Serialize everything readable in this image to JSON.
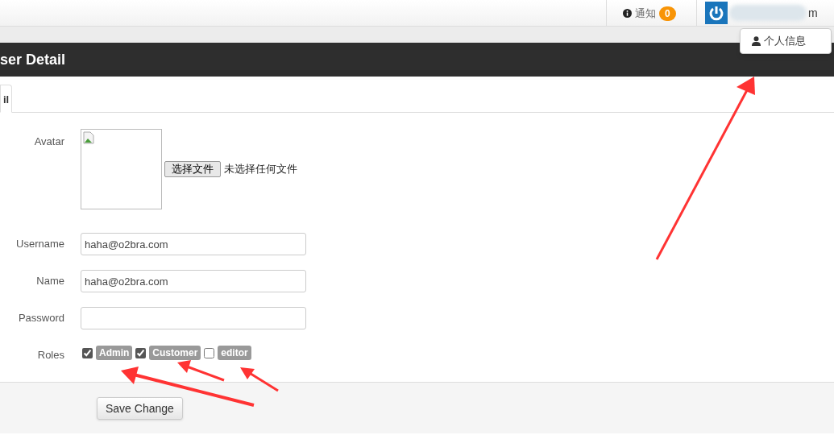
{
  "top_bar": {
    "notifications": {
      "label": "通知",
      "count": "0"
    },
    "user": {
      "name_tail": "m"
    },
    "dropdown": {
      "items": [
        "个人信息"
      ]
    }
  },
  "header": {
    "title": "ser Detail"
  },
  "tabs": [
    {
      "label": "il",
      "selected": true
    }
  ],
  "form": {
    "avatar": {
      "label": "Avatar",
      "file_button": "选择文件",
      "file_status": "未选择任何文件"
    },
    "fields": [
      {
        "label": "Username",
        "value": "haha@o2bra.com"
      },
      {
        "label": "Name",
        "value": "haha@o2bra.com"
      },
      {
        "label": "Password"
      }
    ],
    "roles": {
      "label": "Roles",
      "items": [
        {
          "name": "Admin",
          "checked": true
        },
        {
          "name": "Customer",
          "checked": true
        },
        {
          "name": "editor",
          "checked": false
        }
      ]
    },
    "submit": "Save Change"
  }
}
